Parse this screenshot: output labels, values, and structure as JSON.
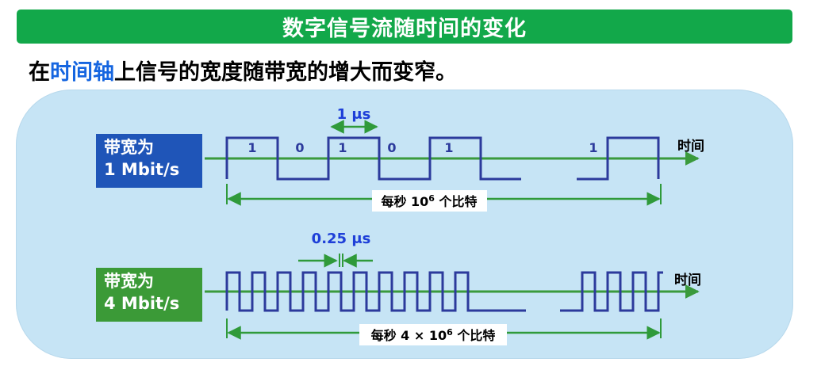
{
  "title": "数字信号流随时间的变化",
  "subtitle": {
    "prefix": "在",
    "highlight": "时间轴",
    "suffix": "上信号的宽度随带宽的增大而变窄。"
  },
  "diagram1": {
    "label_line1": "带宽为",
    "label_line2": "1 Mbit/s",
    "bit_labels": [
      "1",
      "0",
      "1",
      "0",
      "1",
      "1"
    ],
    "duration_label": "1 μs",
    "axis_label": "时间",
    "span_text": "每秒 10",
    "span_sup": "6",
    "span_tail": " 个比特"
  },
  "diagram2": {
    "label_line1": "带宽为",
    "label_line2": "4 Mbit/s",
    "duration_label": "0.25 μs",
    "axis_label": "时间",
    "span_text": "每秒 4 × 10",
    "span_sup": "6",
    "span_tail": " 个比特"
  },
  "colors": {
    "title_bg": "#12a84a",
    "highlight": "#1565e0",
    "panel_bg": "#c6e4f5",
    "label1_bg": "#1f55b8",
    "label2_bg": "#3b9a37",
    "signal": "#2c3a9c",
    "axis": "#3a9a3c",
    "measure": "#2f9a3a",
    "duration_text": "#1e3fd8"
  }
}
